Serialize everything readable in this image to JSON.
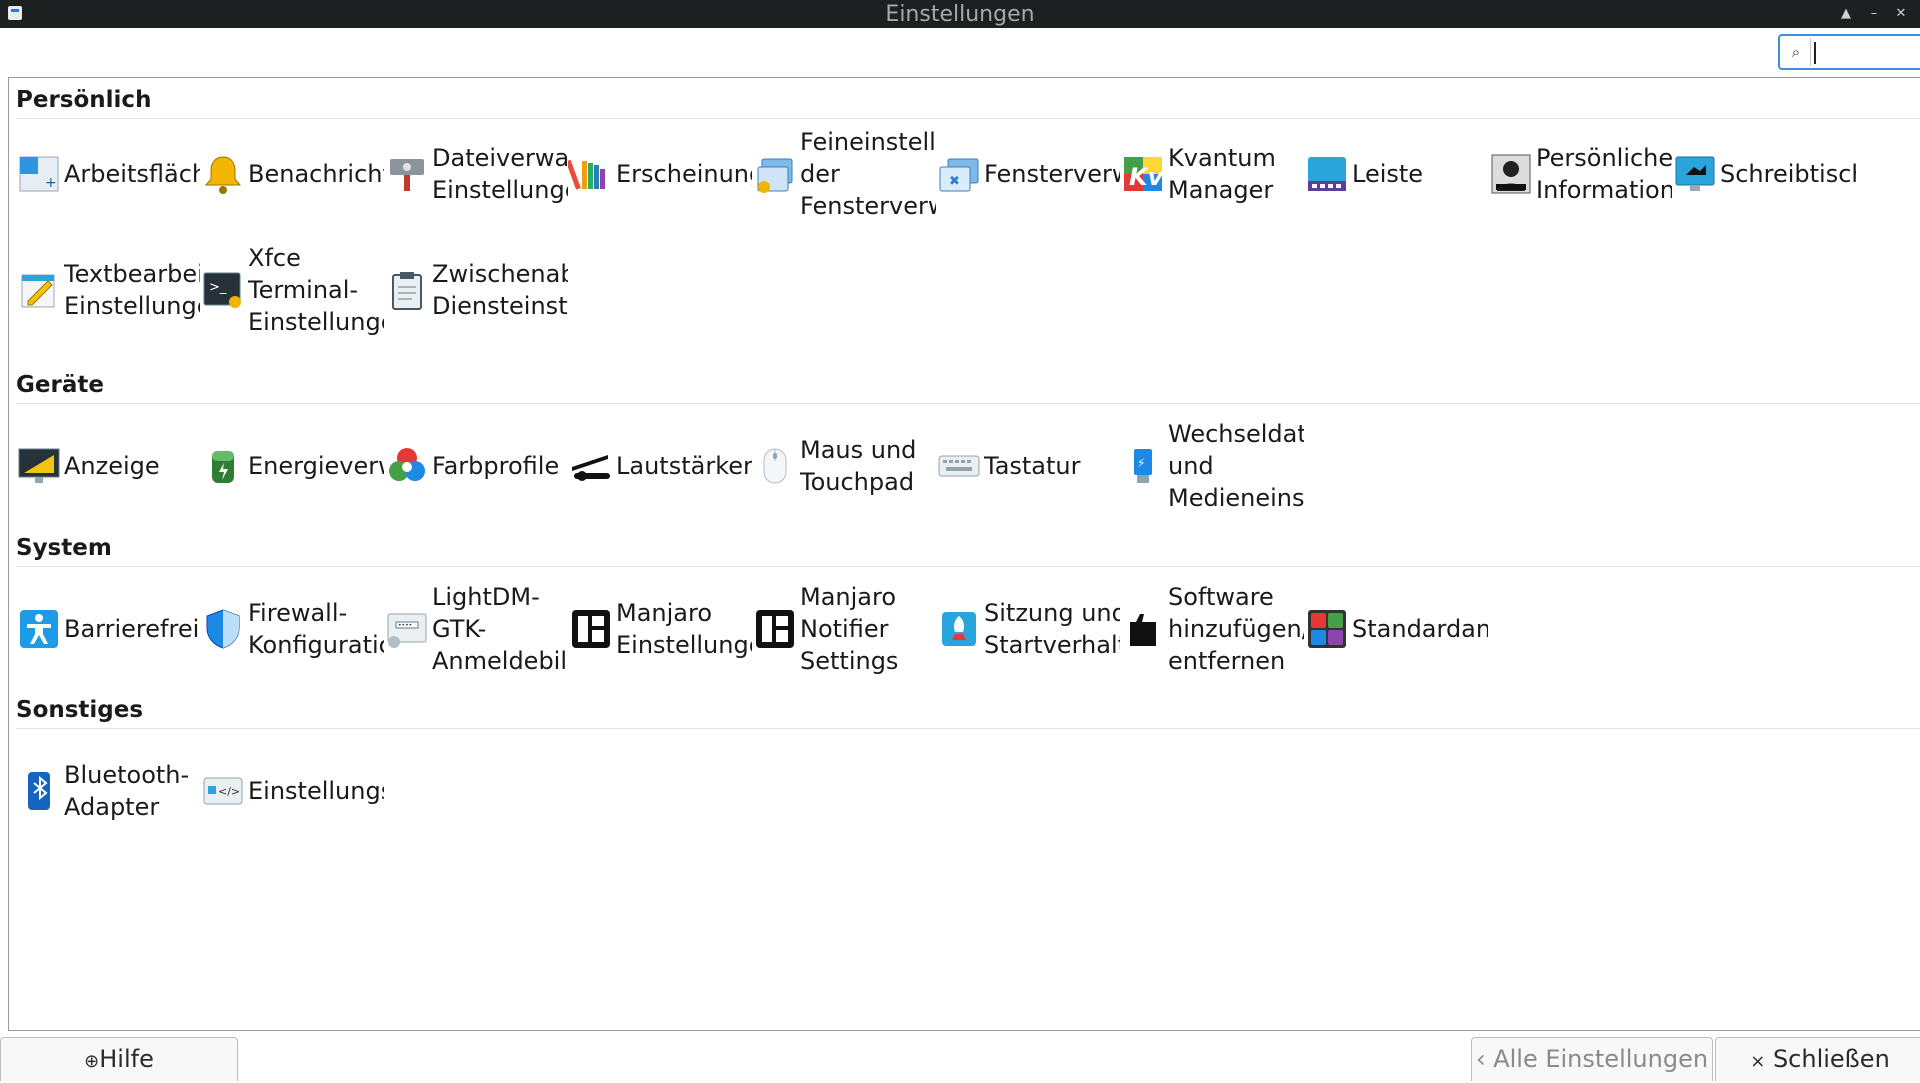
{
  "window": {
    "title": "Einstellungen"
  },
  "search": {
    "value": ""
  },
  "categories": [
    {
      "label": "Persönlich",
      "items": [
        {
          "lines": [
            "Arbeitsfläch"
          ],
          "icon": "desktop-icon"
        },
        {
          "lines": [
            "Benachricht"
          ],
          "icon": "bell-icon"
        },
        {
          "lines": [
            "Dateiverwal",
            "Einstellunge"
          ],
          "icon": "file-manager-icon"
        },
        {
          "lines": [
            "Erscheinung"
          ],
          "icon": "appearance-icon"
        },
        {
          "lines": [
            "Feineinstellu",
            "der",
            "Fensterverw"
          ],
          "icon": "window-tweaks-icon"
        },
        {
          "lines": [
            "Fensterverw"
          ],
          "icon": "window-manager-icon"
        },
        {
          "lines": [
            "Kvantum",
            "Manager"
          ],
          "icon": "kvantum-icon"
        },
        {
          "lines": [
            "Leiste"
          ],
          "icon": "panel-icon"
        },
        {
          "lines": [
            "Persönliche",
            "Information"
          ],
          "icon": "user-info-icon"
        },
        {
          "lines": [
            "Schreibtisch"
          ],
          "icon": "workspace-icon"
        },
        {
          "lines": [
            "Textbearbeit",
            "Einstellunge"
          ],
          "icon": "text-editor-icon"
        },
        {
          "lines": [
            "Xfce",
            "Terminal-",
            "Einstellunge"
          ],
          "icon": "terminal-icon"
        },
        {
          "lines": [
            "Zwischenabl",
            "Diensteinste"
          ],
          "icon": "clipboard-icon"
        }
      ]
    },
    {
      "label": "Geräte",
      "items": [
        {
          "lines": [
            "Anzeige"
          ],
          "icon": "display-icon"
        },
        {
          "lines": [
            "Energieverw"
          ],
          "icon": "battery-icon"
        },
        {
          "lines": [
            "Farbprofile"
          ],
          "icon": "color-profile-icon"
        },
        {
          "lines": [
            "Lautstärkere"
          ],
          "icon": "volume-icon"
        },
        {
          "lines": [
            "Maus und",
            "Touchpad"
          ],
          "icon": "mouse-icon"
        },
        {
          "lines": [
            "Tastatur"
          ],
          "icon": "keyboard-icon"
        },
        {
          "lines": [
            "Wechseldate",
            "und",
            "Medieneinst"
          ],
          "icon": "usb-icon"
        }
      ]
    },
    {
      "label": "System",
      "items": [
        {
          "lines": [
            "Barrierefreil"
          ],
          "icon": "accessibility-icon"
        },
        {
          "lines": [
            "Firewall-",
            "Konfiguratic"
          ],
          "icon": "firewall-icon"
        },
        {
          "lines": [
            "LightDM-",
            "GTK-",
            "Anmeldebilc"
          ],
          "icon": "login-screen-icon"
        },
        {
          "lines": [
            "Manjaro",
            "Einstellunge"
          ],
          "icon": "manjaro-icon"
        },
        {
          "lines": [
            "Manjaro",
            "Notifier",
            "Settings"
          ],
          "icon": "manjaro-notifier-icon"
        },
        {
          "lines": [
            "Sitzung und",
            "Startverhalt"
          ],
          "icon": "session-icon"
        },
        {
          "lines": [
            "Software",
            "hinzufügen/",
            "entfernen"
          ],
          "icon": "software-icon"
        },
        {
          "lines": [
            "Standardanw"
          ],
          "icon": "default-apps-icon"
        }
      ]
    },
    {
      "label": "Sonstiges",
      "items": [
        {
          "lines": [
            "Bluetooth-",
            "Adapter"
          ],
          "icon": "bluetooth-icon"
        },
        {
          "lines": [
            "Einstellungs"
          ],
          "icon": "settings-editor-icon"
        }
      ]
    }
  ],
  "footer": {
    "help": "Hilfe",
    "all_settings": "Alle Einstellungen",
    "close": "Schließen"
  }
}
